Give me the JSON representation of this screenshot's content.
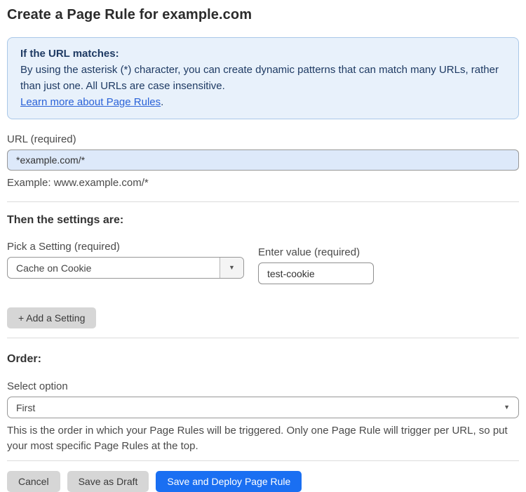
{
  "page": {
    "title": "Create a Page Rule for example.com"
  },
  "info_box": {
    "heading": "If the URL matches:",
    "body": "By using the asterisk (*) character, you can create dynamic patterns that can match many URLs, rather than just one. All URLs are case insensitive.",
    "link_label": "Learn more about Page Rules",
    "link_suffix": "."
  },
  "url_field": {
    "label": "URL (required)",
    "value": "*example.com/*",
    "helper": "Example: www.example.com/*"
  },
  "settings_section": {
    "heading": "Then the settings are:",
    "setting_label": "Pick a Setting (required)",
    "setting_value": "Cache on Cookie",
    "value_label": "Enter value (required)",
    "value_value": "test-cookie",
    "add_button_label": "+ Add a Setting"
  },
  "order_section": {
    "heading": "Order:",
    "select_label": "Select option",
    "select_value": "First",
    "helper": "This is the order in which your Page Rules will be triggered. Only one Page Rule will trigger per URL, so put your most specific Page Rules at the top."
  },
  "actions": {
    "cancel_label": "Cancel",
    "save_draft_label": "Save as Draft",
    "save_deploy_label": "Save and Deploy Page Rule"
  },
  "icons": {
    "dropdown_arrow": "▼"
  },
  "colors": {
    "accent_blue": "#1a6ff2",
    "info_box_bg": "#e8f1fb",
    "info_box_border": "#a9c7e8",
    "info_text": "#1e3a63",
    "link_blue": "#2a62d8",
    "url_input_bg": "#dde9fa",
    "gray_button_bg": "#d6d6d6"
  }
}
